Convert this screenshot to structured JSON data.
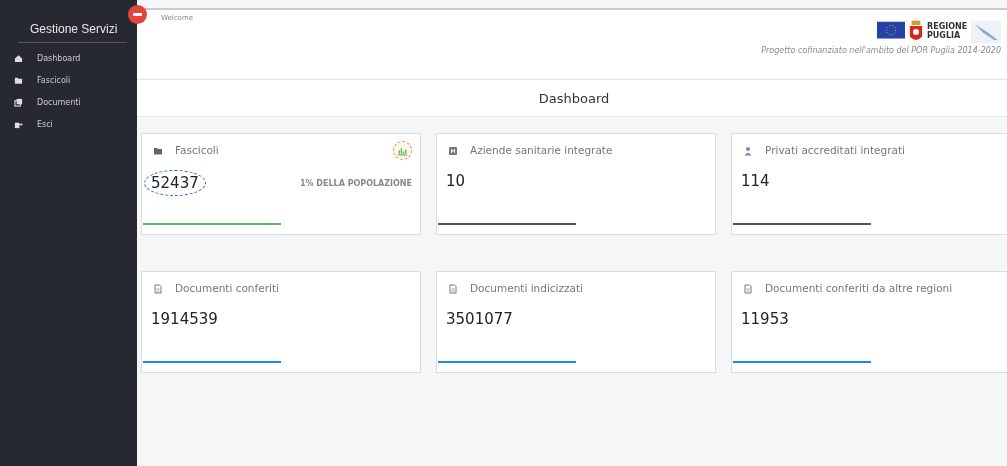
{
  "sidebar": {
    "title": "Gestione Servizi",
    "items": [
      {
        "label": "Dashboard"
      },
      {
        "label": "Fascicoli"
      },
      {
        "label": "Documenti"
      },
      {
        "label": "Esci"
      }
    ]
  },
  "header": {
    "welcome": "Welcome",
    "logo_text": "REGIONE PUGLIA",
    "caption": "Progetto cofinanziato nell'ambito del POR Puglia 2014-2020"
  },
  "page_title": "Dashboard",
  "card_rows": [
    [
      {
        "title": "Fascicoli",
        "value": "52437",
        "value_circled": true,
        "chart_button": true,
        "note": "1% DELLA POPOLAZIONE",
        "color": "#5cb85c"
      },
      {
        "title": "Aziende sanitarie integrate",
        "value": "10",
        "value_circled": false,
        "chart_button": false,
        "color": "#555555"
      },
      {
        "title": "Privati accreditati integrati",
        "value": "114",
        "value_circled": false,
        "chart_button": false,
        "color": "#555555"
      }
    ],
    [
      {
        "title": "Documenti conferiti",
        "value": "1914539",
        "value_circled": false,
        "chart_button": false,
        "color": "#1e88e5"
      },
      {
        "title": "Documenti indicizzati",
        "value": "3501077",
        "value_circled": false,
        "chart_button": false,
        "color": "#1e88e5"
      },
      {
        "title": "Documenti conferiti da altre regioni",
        "value": "11953",
        "value_circled": false,
        "chart_button": false,
        "color": "#1e88e5"
      }
    ]
  ]
}
